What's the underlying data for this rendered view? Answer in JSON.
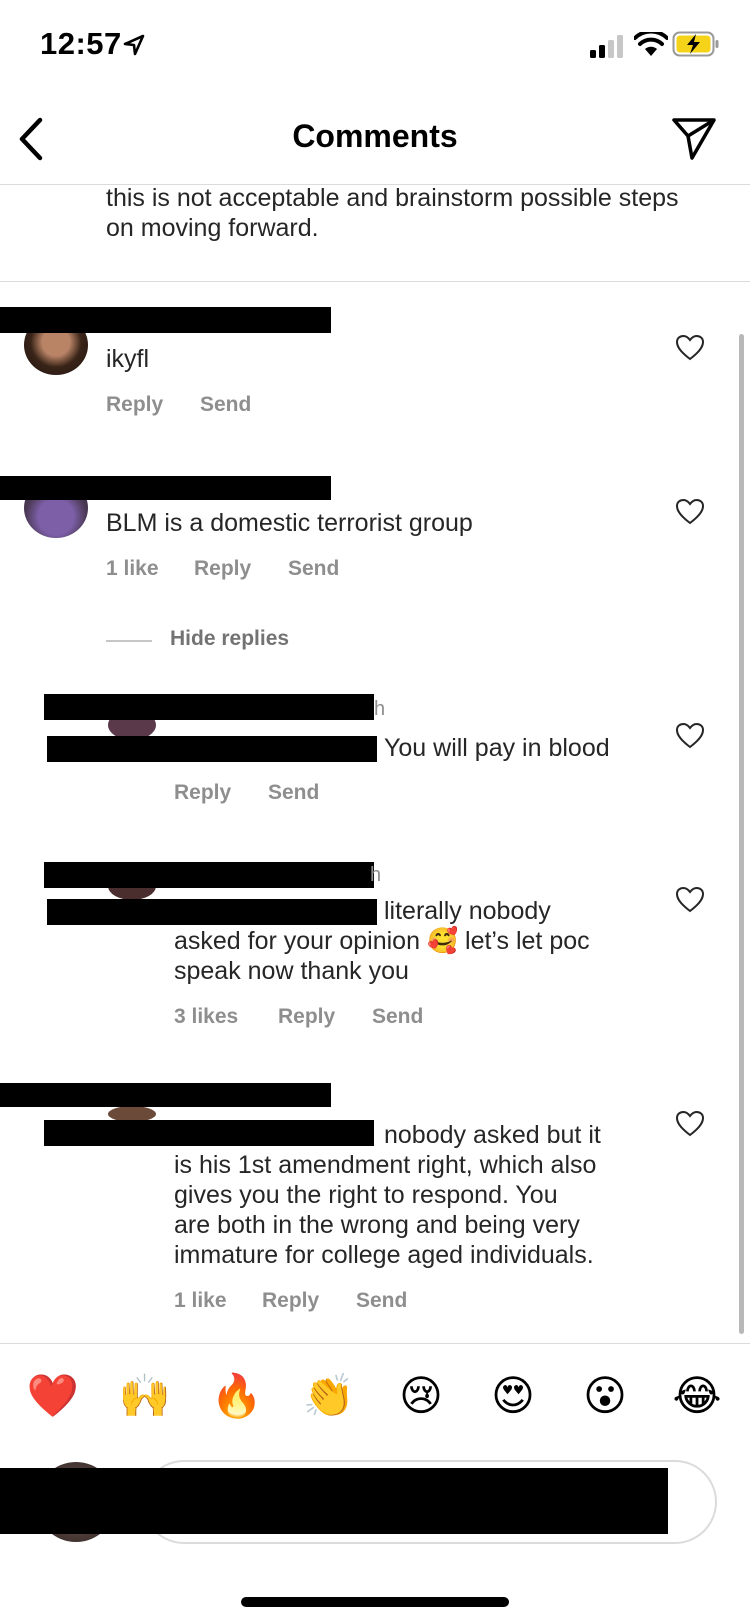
{
  "status_bar": {
    "time": "12:57"
  },
  "header": {
    "title": "Comments"
  },
  "caption_tail": "this is not acceptable and brainstorm possible steps on moving forward.",
  "comments": [
    {
      "text": "ikyfl",
      "likes": "",
      "reply": "Reply",
      "send": "Send"
    },
    {
      "text": "BLM is a domestic terrorist group",
      "likes": "1 like",
      "reply": "Reply",
      "send": "Send"
    }
  ],
  "hide_replies": "Hide replies",
  "replies": [
    {
      "time_fragment": "h",
      "text": "You will pay in blood",
      "likes": "",
      "reply": "Reply",
      "send": "Send"
    },
    {
      "time_fragment": "h",
      "text_line1": "literally nobody",
      "text_line2a": "asked for your opinion ",
      "emoji": "🥰",
      "text_line2b": " let’s let poc",
      "text_line3": "speak now thank you",
      "likes": "3 likes",
      "reply": "Reply",
      "send": "Send"
    },
    {
      "line1": "nobody asked but it",
      "line2": "is his 1st amendment right, which also",
      "line3": "gives you the right to respond. You",
      "line4": "are both in the wrong and being very",
      "line5": "immature for college aged individuals.",
      "likes": "1 like",
      "reply": "Reply",
      "send": "Send"
    }
  ],
  "quick_reactions": [
    "❤️",
    "🙌",
    "🔥",
    "👏",
    "😢",
    "😍",
    "😮",
    "😂"
  ]
}
